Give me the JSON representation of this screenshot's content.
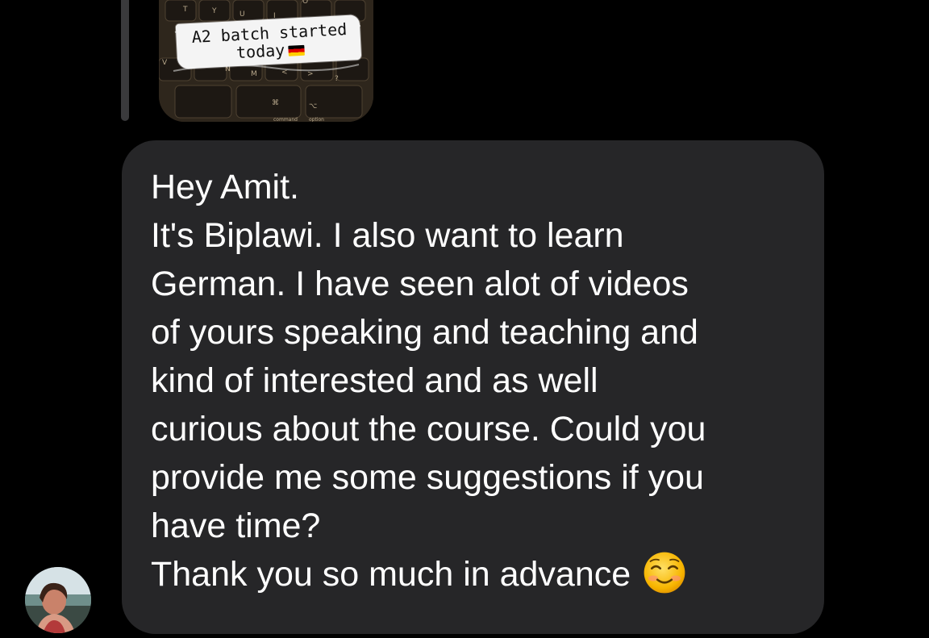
{
  "story_reply": {
    "caption_line1": "A2 batch started",
    "caption_line2": "today",
    "flag_icon": "germany-flag-icon",
    "keyboard_keys": [
      "T",
      "Y",
      "U",
      "I",
      "O",
      "N",
      "M",
      "<",
      ">",
      "?",
      "⌘",
      "⌥",
      "command",
      "option",
      "V"
    ]
  },
  "message": {
    "lines": [
      "Hey Amit.",
      "It's Biplawi. I also want to learn",
      "German. I have seen alot of videos",
      "of yours speaking and teaching and",
      "kind of interested and as well",
      "curious about the course. Could you",
      "provide me some suggestions if you",
      "have time?",
      "Thank you so much in advance"
    ],
    "emoji": "smiling-face-icon"
  },
  "sender": {
    "avatar": "sender-avatar"
  },
  "colors": {
    "background": "#000000",
    "bubble": "#262628",
    "text": "#ffffff",
    "reply_bar": "#3a3a3c"
  }
}
